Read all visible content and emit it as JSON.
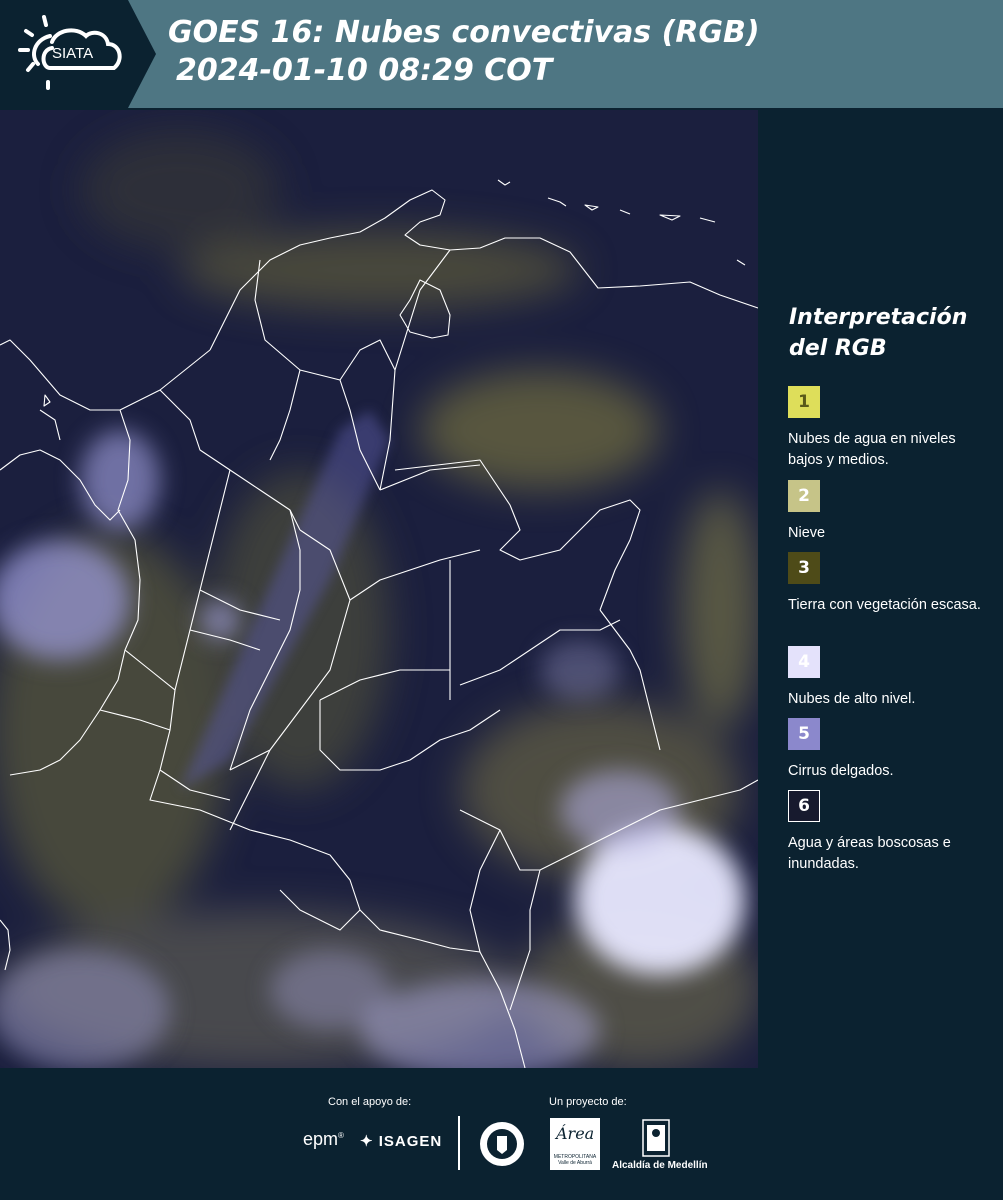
{
  "header": {
    "logo_text": "SIATA",
    "title_line1": "GOES 16: Nubes convectivas (RGB)",
    "title_line2": "2024-01-10 08:29 COT"
  },
  "map": {
    "description": "Satellite RGB composite over Colombia with department boundaries",
    "colors": {
      "background": "#1b1f3e",
      "boundary": "#ffffff",
      "cloud_low": "#c9c46a",
      "cloud_high": "#c8c8f5"
    }
  },
  "legend": {
    "title_line1": "Interpretación",
    "title_line2": "del RGB",
    "items": [
      {
        "number": "1",
        "color": "#dede5a",
        "text_color": "#5a5a1a",
        "text": "Nubes de agua en niveles bajos y medios."
      },
      {
        "number": "2",
        "color": "#c6c488",
        "text_color": "#ffffff",
        "text": "Nieve"
      },
      {
        "number": "3",
        "color": "#4e4b18",
        "text_color": "#ffffff",
        "text": "Tierra con vegetación escasa."
      },
      {
        "number": "4",
        "color": "#e4e2fb",
        "text_color": "#ffffff",
        "text": "Nubes de alto nivel."
      },
      {
        "number": "5",
        "color": "#8b88cc",
        "text_color": "#ffffff",
        "text": "Cirrus delgados."
      },
      {
        "number": "6",
        "color": "#171a2e",
        "text_color": "#ffffff",
        "text": "Agua y áreas boscosas e inundadas."
      }
    ]
  },
  "footer": {
    "support_label": "Con el apoyo de:",
    "project_label": "Un proyecto de:",
    "epm": "epm",
    "isagen": "ISAGEN",
    "area_script": "Área",
    "area_sub": "METROPOLITANA Valle de Aburrá",
    "alcaldia": "Alcaldía de Medellín"
  }
}
